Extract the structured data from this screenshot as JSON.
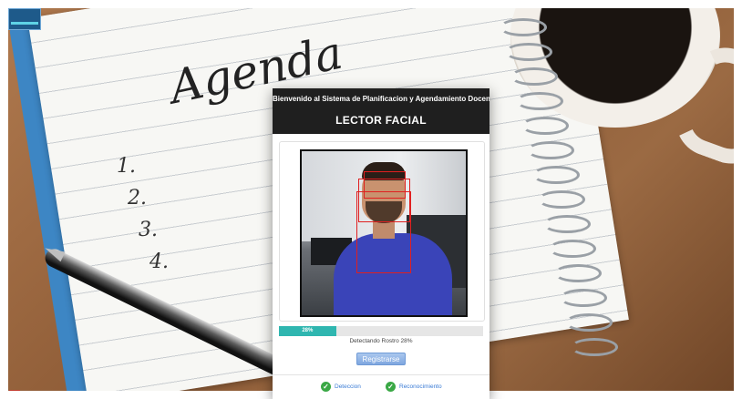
{
  "app": {
    "header_title": "Bienvenido al Sistema de Planificacion y Agendamiento Docente",
    "header_subtitle": "LECTOR FACIAL"
  },
  "background": {
    "notebook_word": "Agenda",
    "list_numbers": [
      "1.",
      "2.",
      "3.",
      "4."
    ]
  },
  "face_reader": {
    "progress_percent": 28,
    "progress_label": "28%",
    "status_text": "Detectando Rostro 28%",
    "register_button_label": "Registrarse",
    "steps": [
      {
        "label": "Deteccion",
        "icon": "check-circle-icon"
      },
      {
        "label": "Reconocimiento",
        "icon": "check-circle-icon"
      }
    ]
  },
  "colors": {
    "header_bg": "#1f1f1f",
    "progress": "#2fb6b0",
    "detection_box": "#e02020",
    "step_check": "#3aa845",
    "step_text": "#3a7bd5"
  }
}
